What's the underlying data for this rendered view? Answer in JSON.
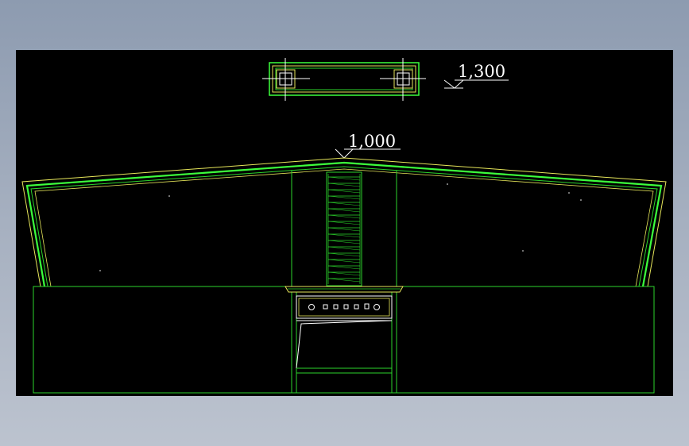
{
  "colors": {
    "background": "#000000",
    "frame": "#c8d0dc",
    "line_green": "#2bd42b",
    "line_bright_green": "#3cff3c",
    "line_yellow": "#e6e65a",
    "text": "#ffffff"
  },
  "drawing": {
    "elevation_top": {
      "label": "1,300"
    },
    "elevation_ridge": {
      "label": "1,000"
    }
  }
}
